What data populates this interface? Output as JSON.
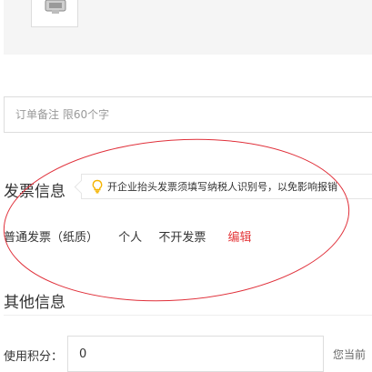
{
  "product": {
    "thumbnail_icon": "product-thumbnail-icon"
  },
  "order_remark": {
    "placeholder": "订单备注 限60个字",
    "value": ""
  },
  "invoice": {
    "section_title": "发票信息",
    "tip_icon": "lightbulb-icon",
    "tip_text": "开企业抬头发票须填写纳税人识别号，以免影响报销",
    "type": "普通发票（纸质）",
    "title_type": "个人",
    "content": "不开发票",
    "edit_label": "编辑"
  },
  "other_info": {
    "section_title": "其他信息",
    "points_label": "使用积分：",
    "points_value": "0",
    "points_available_text": "您当前"
  },
  "colors": {
    "accent_red": "#e4393c",
    "annotation_ellipse": "#e0303a",
    "tip_icon": "#f5b400",
    "product_area_bg": "#f5f5f5"
  }
}
